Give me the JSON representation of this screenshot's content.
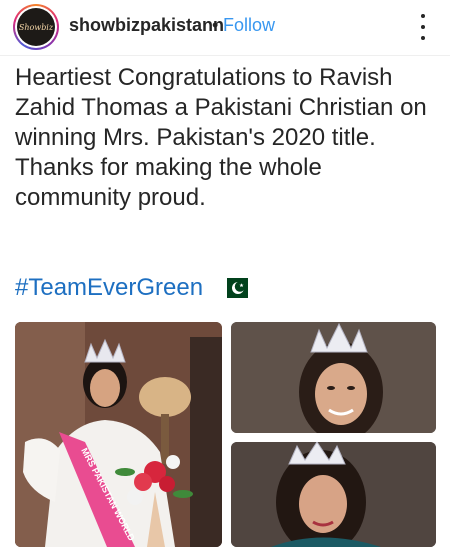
{
  "post": {
    "username": "showbizpakistann",
    "separator": "•",
    "follow_label": "Follow",
    "avatar_text": "Showbiz",
    "caption": "Heartiest Congratulations to Ravish Zahid Thomas a Pakistani Christian on winning Mrs. Pakistan's 2020 title. Thanks for making the whole community proud.",
    "hashtag": "#TeamEverGreen",
    "flag_icon": "pakistan-flag-icon",
    "more_icon": "more-vertical-icon"
  },
  "images": [
    {
      "alt": "Crowned woman in white dress with sash and bouquet",
      "sash_text": "MRS PAKISTAN WORLD"
    },
    {
      "alt": "Close-up of crowned woman smiling"
    },
    {
      "alt": "Crowned woman in sequined dress"
    }
  ],
  "colors": {
    "follow": "#3897f0",
    "hashtag": "#1d6fc1",
    "text": "#262626",
    "flag_green": "#01411c",
    "sash": "#e94c91"
  }
}
